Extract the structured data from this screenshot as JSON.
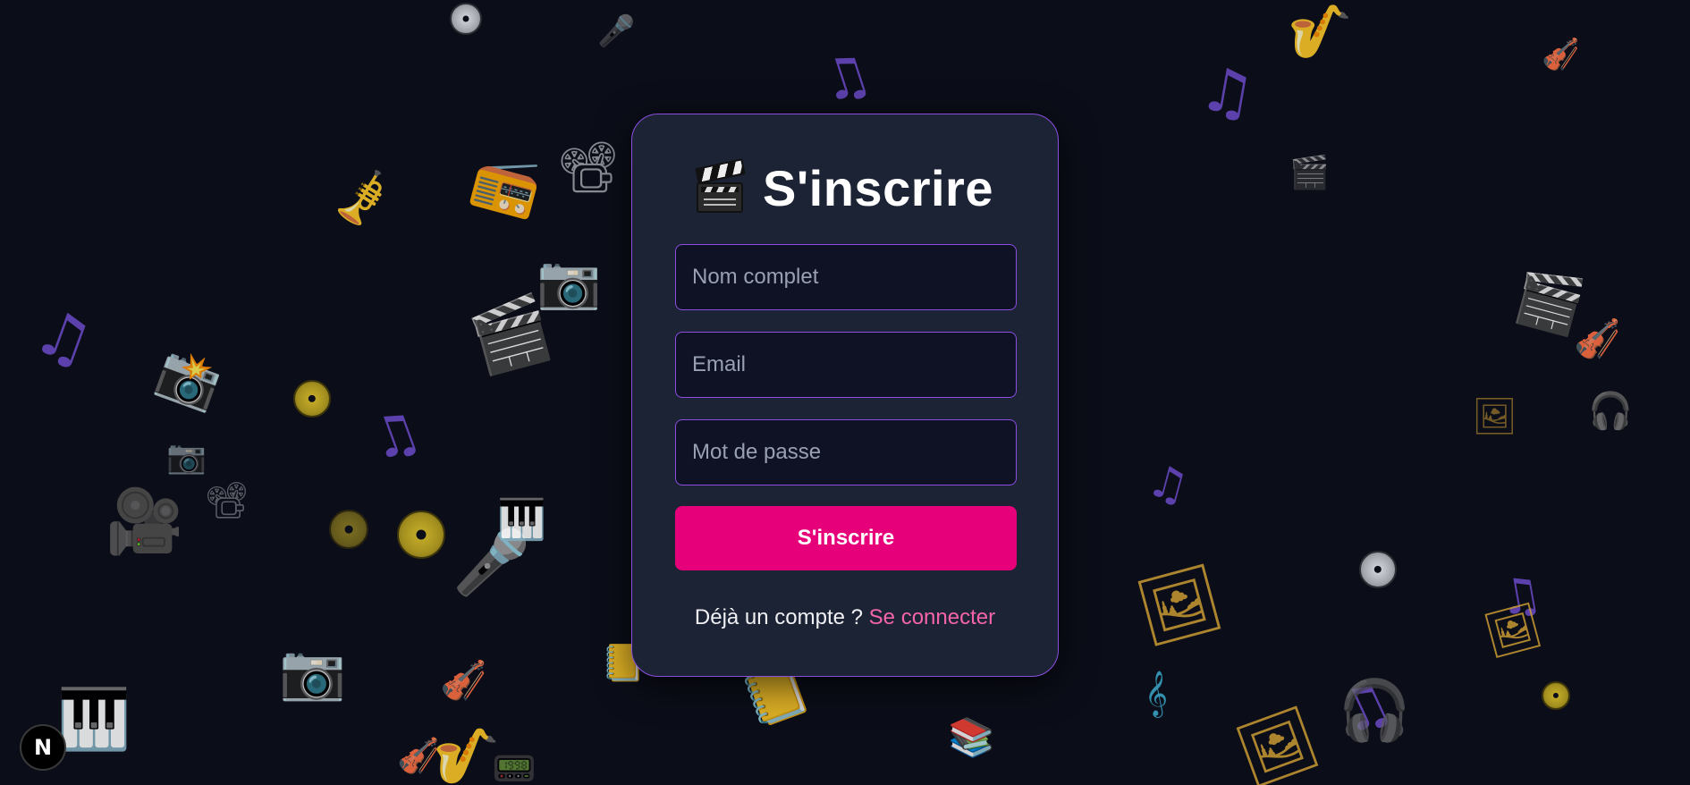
{
  "form": {
    "title": "S'inscrire",
    "name_placeholder": "Nom complet",
    "email_placeholder": "Email",
    "password_placeholder": "Mot de passe",
    "submit_label": "S'inscrire",
    "login_prompt": "Déjà un compte ?",
    "login_link": "Se connecter"
  },
  "dev_badge": {
    "label": "N"
  },
  "colors": {
    "background": "#0b0d18",
    "card": "#1c2335",
    "card_border": "#8b4fe0",
    "accent": "#e6007a",
    "link": "#f564a9"
  },
  "icons": {
    "heading": "clapperboard-icon",
    "background": [
      "music-notes-icon",
      "camera-icon",
      "clapperboard-icon",
      "disc-icon",
      "microphone-icon",
      "saxophone-icon",
      "violin-icon",
      "piano-keys-icon",
      "film-projector-icon",
      "radio-icon",
      "headphones-icon",
      "framed-picture-icon",
      "books-icon",
      "treble-clef-icon"
    ]
  }
}
